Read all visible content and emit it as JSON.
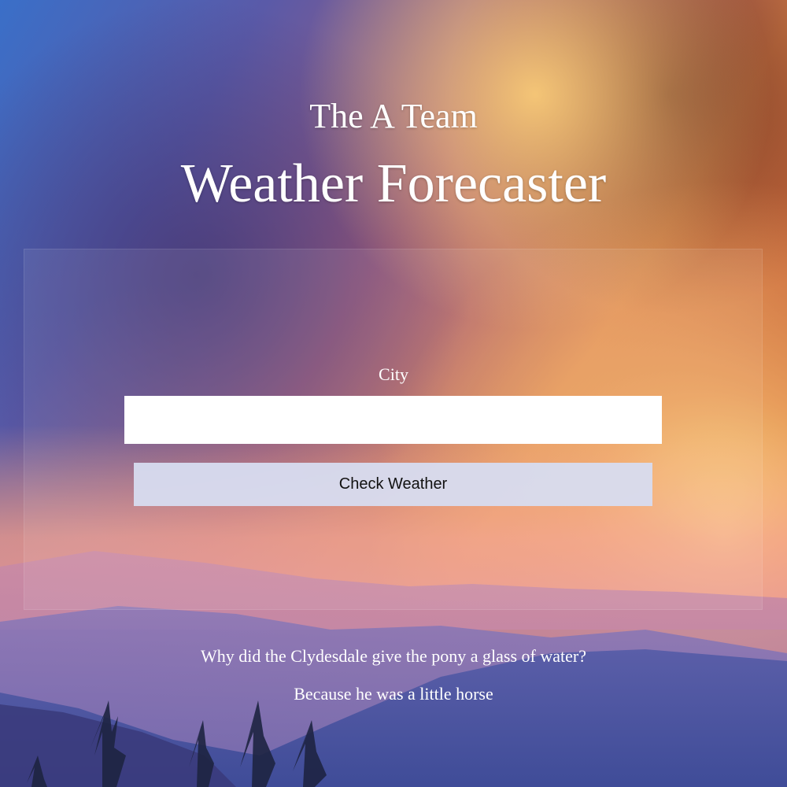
{
  "header": {
    "subtitle": "The A Team",
    "title": "Weather Forecaster"
  },
  "form": {
    "city_label": "City",
    "city_value": "",
    "city_placeholder": "",
    "button_label": "Check Weather"
  },
  "joke": {
    "question": "Why did the Clydesdale give the pony a glass of water?",
    "answer": "Because he was a little horse"
  },
  "colors": {
    "text": "#ffffff",
    "button_bg": "#d7dcf0",
    "input_bg": "#ffffff"
  }
}
